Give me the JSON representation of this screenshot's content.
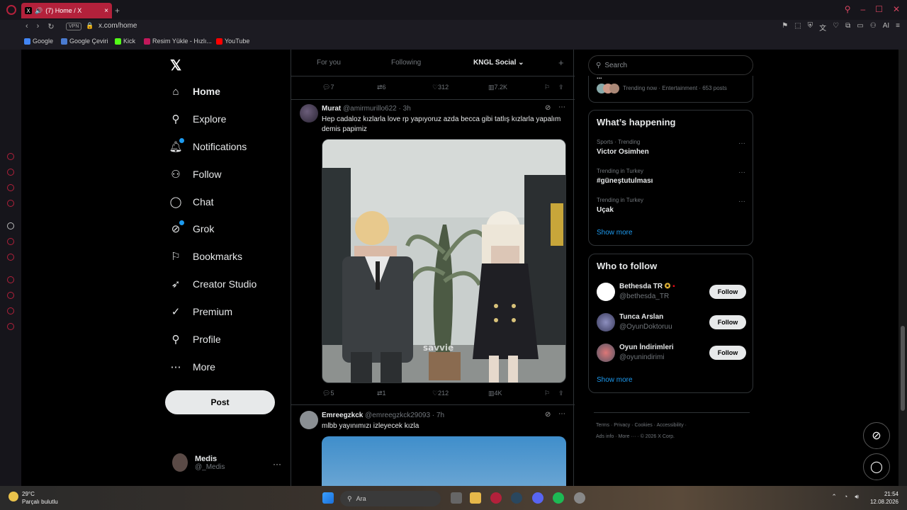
{
  "browser": {
    "tab_title": "(7) Home / X",
    "tab_close": "×",
    "new_tab": "+",
    "vpn": "VPN",
    "url": "x.com/home",
    "ai": "AI",
    "bookmarks": [
      {
        "label": "Google",
        "color": "#4285f4"
      },
      {
        "label": "Google Çeviri",
        "color": "#4a7bd0"
      },
      {
        "label": "Kick",
        "color": "#53fc18"
      },
      {
        "label": "Resim Yükle - Hızlı...",
        "color": "#c2185b"
      },
      {
        "label": "YouTube",
        "color": "#ff0000"
      }
    ]
  },
  "nav": {
    "logo": "𝕏",
    "items": [
      {
        "label": "Home",
        "icon": "home-icon"
      },
      {
        "label": "Explore",
        "icon": "search-icon"
      },
      {
        "label": "Notifications",
        "icon": "bell-icon"
      },
      {
        "label": "Follow",
        "icon": "person-add-icon"
      },
      {
        "label": "Chat",
        "icon": "chat-icon"
      },
      {
        "label": "Grok",
        "icon": "grok-icon"
      },
      {
        "label": "Bookmarks",
        "icon": "bookmark-icon"
      },
      {
        "label": "Creator Studio",
        "icon": "rocket-icon"
      },
      {
        "label": "Premium",
        "icon": "verified-icon"
      },
      {
        "label": "Profile",
        "icon": "profile-icon"
      },
      {
        "label": "More",
        "icon": "more-icon"
      }
    ],
    "post_label": "Post",
    "user_name": "Medis",
    "user_handle": "@_Medis",
    "user_more": "···"
  },
  "timeline": {
    "tabs": [
      "For you",
      "Following",
      "KNGL Social ⌄"
    ],
    "add_tab": "+",
    "prev_actions": {
      "replies": "7",
      "reposts": "6",
      "likes": "312",
      "views": "7.2K"
    },
    "tweets": [
      {
        "name": "Murat",
        "handle": "@amirmurillo622 · 3h",
        "text": "Hep cadaloz kızlarla love rp yapıyoruz  azda becca gibi tatlış kızlarla yapalım demis papimiz",
        "watermark": "savvie",
        "replies": "5",
        "reposts": "1",
        "likes": "212",
        "views": "4K"
      },
      {
        "name": "Emreegzkck",
        "handle": "@emreegzkck29093 · 7h",
        "text": "mlbb yayınımızı izleyecek kızla"
      }
    ]
  },
  "right": {
    "search_placeholder": "Search",
    "top_trend_cut": "...",
    "top_trend_meta": "Trending now · Entertainment · 653 posts",
    "happening_title": "What’s happening",
    "trends": [
      {
        "meta": "Sports · Trending",
        "name": "Victor Osimhen"
      },
      {
        "meta": "Trending in Turkey",
        "name": "#güneştutulması"
      },
      {
        "meta": "Trending in Turkey",
        "name": "Uçak"
      }
    ],
    "trend_more": "···",
    "show_more": "Show more",
    "who_title": "Who to follow",
    "follow_suggestions": [
      {
        "name": "Bethesda TR",
        "handle": "@bethesda_TR",
        "button": "Follow"
      },
      {
        "name": "Tunca Arslan",
        "handle": "@OyunDoktoruu",
        "button": "Follow"
      },
      {
        "name": "Oyun İndirimleri",
        "handle": "@oyunindirimi",
        "button": "Follow"
      }
    ],
    "footer_line1": "Terms  ·  Privacy  ·  Cookies  ·  Accessibility  ·",
    "footer_line2": "Ads info  ·  More ···  ·  © 2026 X Corp."
  },
  "taskbar": {
    "temp": "29°C",
    "weather": "Parçalı bulutlu",
    "search": "Ara",
    "time": "21:54",
    "date": "12.08.2026"
  }
}
